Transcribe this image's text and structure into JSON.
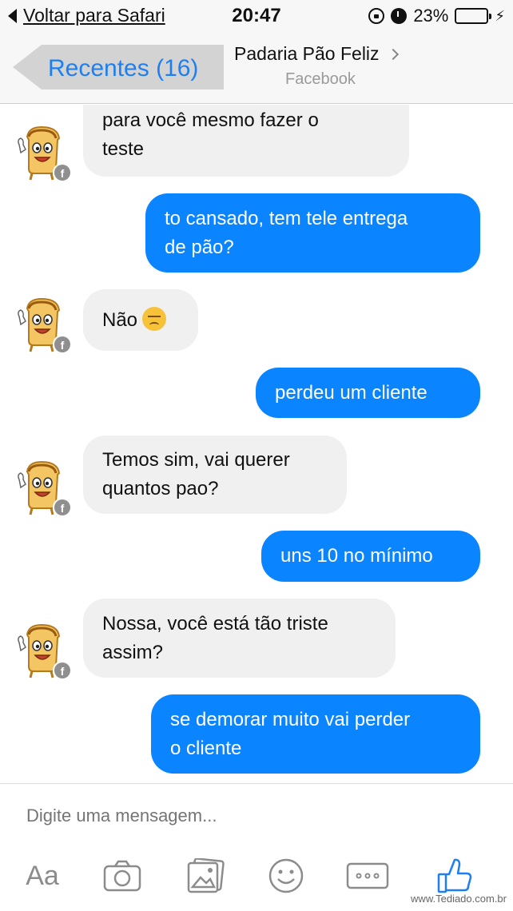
{
  "status_bar": {
    "back_to_app": "Voltar para Safari",
    "time": "20:47",
    "battery_percent": "23%",
    "battery_level": 0.23
  },
  "nav": {
    "back_label": "Recentes (16)",
    "title": "Padaria Pão Feliz",
    "subtitle": "Facebook"
  },
  "messages": [
    {
      "from": "page",
      "lines": [
        "para você mesmo fazer o",
        "teste"
      ]
    },
    {
      "from": "me",
      "lines": [
        "to cansado, tem tele entrega",
        "de pão?"
      ]
    },
    {
      "from": "page",
      "lines": [
        "Não"
      ],
      "emoji": "disappointed-face"
    },
    {
      "from": "me",
      "lines": [
        "perdeu um cliente"
      ]
    },
    {
      "from": "page",
      "lines": [
        "Temos sim, vai querer",
        "quantos pao?"
      ]
    },
    {
      "from": "me",
      "lines": [
        "uns 10 no mínimo"
      ]
    },
    {
      "from": "page",
      "lines": [
        "Nossa, você está tão triste",
        "assim?"
      ]
    },
    {
      "from": "me",
      "lines": [
        "se demorar muito vai perder",
        "o cliente"
      ]
    }
  ],
  "composer": {
    "placeholder": "Digite uma mensagem...",
    "text_format_label": "Aa",
    "tools": [
      "text-format-icon",
      "camera-icon",
      "gallery-icon",
      "emoji-icon",
      "more-icon",
      "like-icon"
    ]
  },
  "watermark": "www.Tediado.com.br",
  "colors": {
    "outgoing_bubble": "#0a84ff",
    "incoming_bubble": "#f0f0f0",
    "link_blue": "#1e7ff0"
  }
}
